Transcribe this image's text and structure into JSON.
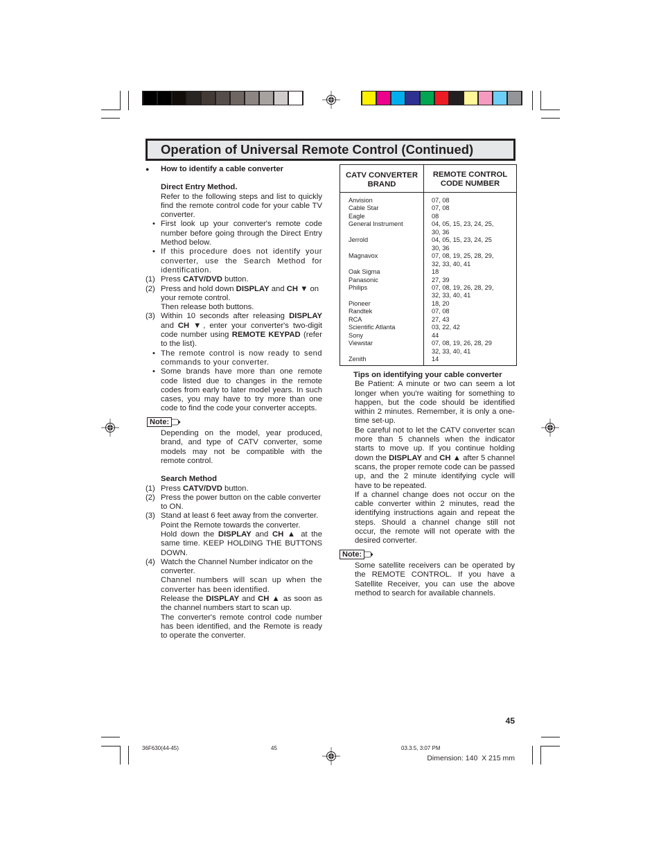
{
  "print_marks": {
    "grayscale_swatches": [
      "#000000",
      "#000000",
      "#120d09",
      "#2a2522",
      "#433a36",
      "#554d49",
      "#6e6561",
      "#8c8582",
      "#a7a2a0",
      "#d0cccb",
      "#ffffff"
    ],
    "color_swatches": [
      "#fff100",
      "#ec008c",
      "#00aeef",
      "#2e3192",
      "#00a651",
      "#ed1c24",
      "#231f20",
      "#fff799",
      "#f49ac1",
      "#6dcff6",
      "#939598"
    ]
  },
  "header": {
    "title": "Operation of Universal Remote Control (Continued)"
  },
  "left": {
    "heading": "How to identify a cable converter",
    "direct_entry": {
      "title": "Direct Entry Method.",
      "intro": "Refer to the following steps and list to quickly find the remote control code for your cable TV converter.",
      "bullets": [
        "First look up your converter's remote code number before going through the Direct Entry Method below.",
        "If this procedure does not identify your converter, use the Search Method for identification."
      ],
      "step1": {
        "num": "(1)",
        "a": "Press ",
        "b": "CATV/DVD",
        "c": " button."
      },
      "step2": {
        "num": "(2)",
        "a": "Press and hold down ",
        "b": "DISPLAY",
        "c": " and ",
        "d": "CH ▼",
        "e": " on your remote control.",
        "f": "Then release both buttons."
      },
      "step3": {
        "num": "(3)",
        "a": "Within 10 seconds after releasing ",
        "b": "DISPLAY",
        "c": " and ",
        "d": "CH ▼",
        "e": ", enter your converter's two-digit code number using ",
        "f": "REMOTE KEYPAD",
        "g": " (refer to the list)."
      },
      "bullets2": [
        "The remote control is now ready to send commands to your converter.",
        "Some brands have more than one remote code listed due to changes in the remote codes from early to later model years. In such cases, you may have to try more than one code to find the code your converter accepts."
      ]
    },
    "note_label": "Note:",
    "note_text": "Depending on the model, year produced, brand, and type of CATV converter, some models may not be compatible with the remote control.",
    "search": {
      "title": "Search Method",
      "step1": {
        "num": "(1)",
        "a": "Press ",
        "b": "CATV/DVD",
        "c": " button."
      },
      "step2": {
        "num": "(2)",
        "a": "Press the power button on the cable converter to ON."
      },
      "step3": {
        "num": "(3)",
        "a": "Stand at least 6 feet away from the converter.",
        "b": "Point the Remote towards the converter.",
        "c": "Hold down the ",
        "d": "DISPLAY",
        "e": " and ",
        "f": "CH ▲",
        "g": " at the same time. KEEP HOLDING THE BUTTONS DOWN."
      },
      "step4": {
        "num": "(4)",
        "a": "Watch the Channel Number indicator on the converter.",
        "b": "Channel numbers will scan up when the converter has been identified.",
        "c": "Release the ",
        "d": "DISPLAY",
        "e": " and ",
        "f": "CH ▲",
        "g": " as soon as the channel numbers start to scan up.",
        "h": "The converter's remote control code number has been identified, and the Remote is ready to operate the converter."
      }
    }
  },
  "table": {
    "col1": "CATV CONVERTER BRAND",
    "col2": "REMOTE CONTROL CODE NUMBER",
    "rows": [
      {
        "brand": "Anvision",
        "codes": [
          "07, 08"
        ]
      },
      {
        "brand": "Cable Star",
        "codes": [
          "07, 08"
        ]
      },
      {
        "brand": "Eagle",
        "codes": [
          "08"
        ]
      },
      {
        "brand": "General Instrument",
        "codes": [
          "04, 05, 15, 23, 24, 25,",
          "30, 36"
        ]
      },
      {
        "brand": "Jerrold",
        "codes": [
          "04, 05, 15, 23, 24, 25",
          "30, 36"
        ]
      },
      {
        "brand": "Magnavox",
        "codes": [
          "07, 08, 19, 25, 28, 29,",
          "32, 33, 40, 41"
        ]
      },
      {
        "brand": "Oak Sigma",
        "codes": [
          "18"
        ]
      },
      {
        "brand": "Panasonic",
        "codes": [
          "27, 39"
        ]
      },
      {
        "brand": "Philips",
        "codes": [
          "07, 08, 19, 26, 28, 29,",
          "32, 33, 40, 41"
        ]
      },
      {
        "brand": "Pioneer",
        "codes": [
          "18, 20"
        ]
      },
      {
        "brand": "Randtek",
        "codes": [
          "07, 08"
        ]
      },
      {
        "brand": "RCA",
        "codes": [
          "27, 43"
        ]
      },
      {
        "brand": "Scientific Atlanta",
        "codes": [
          "03, 22, 42"
        ]
      },
      {
        "brand": "Sony",
        "codes": [
          "44"
        ]
      },
      {
        "brand": "Viewstar",
        "codes": [
          "07, 08, 19, 26, 28, 29",
          "32, 33, 40, 41"
        ]
      },
      {
        "brand": "Zenith",
        "codes": [
          "14"
        ]
      }
    ]
  },
  "right": {
    "tips_title": "Tips on identifying your cable converter",
    "tips_p1": "Be Patient: A minute or two can seem a lot longer when you're waiting for something to happen, but the code should be identified within 2 minutes. Remember, it is only a one-time set-up.",
    "tips_p2a": "Be careful not to let the CATV converter scan more than 5 channels when the indicator starts to move up. If you continue holding down the ",
    "tips_p2b": "DISPLAY",
    "tips_p2c": " and ",
    "tips_p2d": "CH ▲",
    "tips_p2e": " after 5 channel scans, the proper remote code can be passed up, and the 2 minute identifying cycle will have to be repeated.",
    "tips_p3": "If a channel change does not occur on the cable converter within 2 minutes, read the identifying instructions again and repeat the steps. Should a channel change still not occur, the remote will not operate with the desired converter.",
    "note_label": "Note:",
    "note_text": "Some satellite receivers can be operated by the REMOTE CONTROL. If you have a Satellite Receiver, you can use the above method to search for available channels."
  },
  "footer": {
    "page_number": "45",
    "file_name": "36F630(44-45)",
    "slug_page": "45",
    "timestamp": "03.3.5, 3:07 PM",
    "dimension": "Dimension: 140  X 215 mm"
  }
}
